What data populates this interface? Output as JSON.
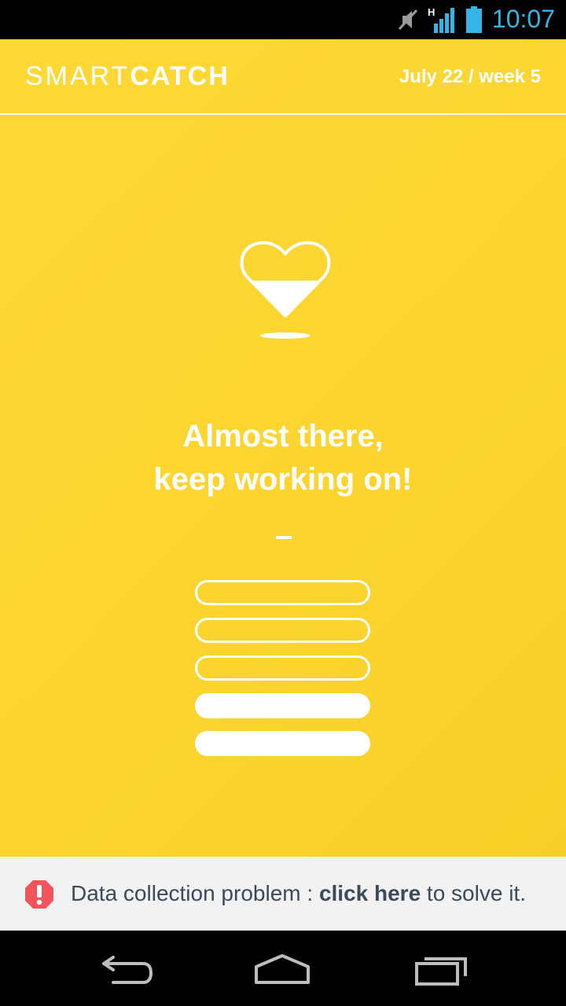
{
  "status_bar": {
    "time": "10:07",
    "network": "H",
    "icons": [
      "mute-icon",
      "signal-icon",
      "battery-icon"
    ],
    "accent_color": "#33b5e5"
  },
  "header": {
    "logo_part1": "SMART",
    "logo_part2": "CATCH",
    "date": "July 22 / week 5"
  },
  "main": {
    "icon": "heart-half-icon",
    "message_line1": "Almost there,",
    "message_line2": "keep working on!",
    "separator": "–",
    "level": {
      "filled": 2,
      "total": 5
    },
    "background_color": "#fcd52f"
  },
  "banner": {
    "icon": "alert-icon",
    "text_before": "Data collection problem : ",
    "link_text": "click here",
    "text_after": " to solve it.",
    "alert_color": "#f2545b"
  },
  "nav_bar": {
    "buttons": [
      "back-icon",
      "home-icon",
      "recents-icon"
    ]
  }
}
